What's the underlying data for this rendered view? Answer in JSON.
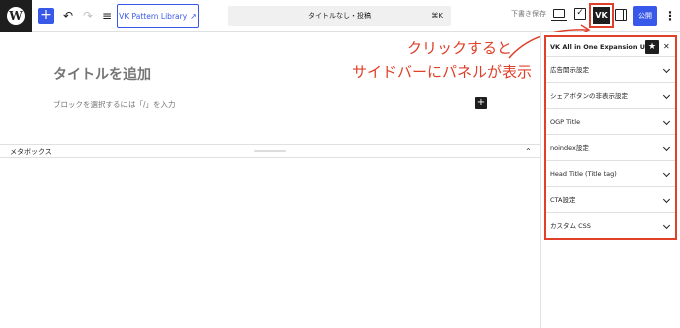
{
  "toolbar": {
    "wp_logo_letter": "W",
    "add_symbol": "+",
    "undo_symbol": "↶",
    "redo_symbol": "↷",
    "list_view_symbol": "≡",
    "pattern_library_label": "VK Pattern Library",
    "pattern_library_icon": "↗",
    "document_title": "タイトルなし・投稿",
    "shortcut": "⌘K",
    "save_draft_label": "下書き保存",
    "check_symbol": "✓",
    "vk_button_symbol": "VK",
    "publish_label": "公開",
    "more_symbol": "⋮"
  },
  "editor": {
    "title_placeholder": "タイトルを追加",
    "block_hint": "ブロックを選択するには「/」を入力",
    "block_add_symbol": "+"
  },
  "annotation": {
    "line1": "クリックすると",
    "line2": "サイドバーにパネルが表示",
    "color": "#e0402a"
  },
  "metabox": {
    "label": "メタボックス",
    "caret_symbol": "⌃"
  },
  "sidebar": {
    "panel_title": "VK All in One Expansion Unit",
    "star_symbol": "★",
    "close_symbol": "✕",
    "items": [
      {
        "label": "広告開示設定"
      },
      {
        "label": "シェアボタンの非表示設定"
      },
      {
        "label": "OGP Title"
      },
      {
        "label": "noindex設定"
      },
      {
        "label": "Head Title (Title tag)"
      },
      {
        "label": "CTA設定"
      },
      {
        "label": "カスタム CSS"
      }
    ]
  },
  "colors": {
    "accent": "#3858e9",
    "highlight": "#e0402a",
    "dark": "#1e1e1e"
  }
}
